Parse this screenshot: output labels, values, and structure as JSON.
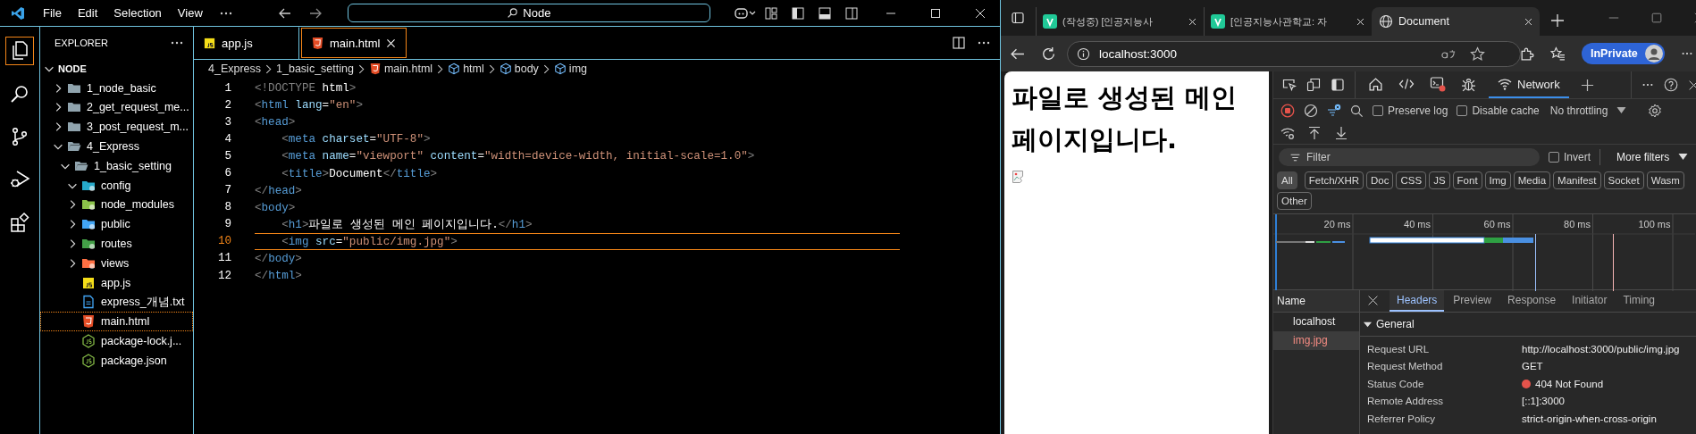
{
  "editor_app": {
    "menu": [
      {
        "label": "File"
      },
      {
        "label": "Edit"
      },
      {
        "label": "Selection"
      },
      {
        "label": "View"
      }
    ],
    "command_center": {
      "value": "Node"
    },
    "activity": [
      {
        "kind": "files",
        "selected": true
      },
      {
        "kind": "search",
        "selected": false
      },
      {
        "kind": "git",
        "selected": false
      },
      {
        "kind": "debug",
        "selected": false
      },
      {
        "kind": "extensions",
        "selected": false
      }
    ],
    "explorer": {
      "title": "EXPLORER",
      "tree": [
        {
          "label": "NODE",
          "kind": "root",
          "expanded": true,
          "selected": false,
          "children": [
            {
              "label": "1_node_basic",
              "kind": "folder",
              "expanded": false,
              "selected": false
            },
            {
              "label": "2_get_request_me...",
              "kind": "folder",
              "expanded": false,
              "selected": false
            },
            {
              "label": "3_post_request_m...",
              "kind": "folder",
              "expanded": false,
              "selected": false
            },
            {
              "label": "4_Express",
              "kind": "folder",
              "expanded": true,
              "selected": false,
              "children": [
                {
                  "label": "1_basic_setting",
                  "kind": "folder",
                  "expanded": true,
                  "selected": false,
                  "children": [
                    {
                      "label": "config",
                      "kind": "config",
                      "expanded": true,
                      "selected": false
                    },
                    {
                      "label": "node_modules",
                      "kind": "node_modules",
                      "expanded": false,
                      "selected": false
                    },
                    {
                      "label": "public",
                      "kind": "public",
                      "expanded": false,
                      "selected": false
                    },
                    {
                      "label": "routes",
                      "kind": "routes",
                      "expanded": false,
                      "selected": false
                    },
                    {
                      "label": "views",
                      "kind": "views",
                      "expanded": false,
                      "selected": false
                    },
                    {
                      "label": "app.js",
                      "kind": "js",
                      "selected": false
                    },
                    {
                      "label": "express_개념.txt",
                      "kind": "txt",
                      "selected": false
                    },
                    {
                      "label": "main.html",
                      "kind": "html",
                      "selected": true
                    },
                    {
                      "label": "package-lock.j...",
                      "kind": "json",
                      "selected": false
                    },
                    {
                      "label": "package.json",
                      "kind": "json",
                      "selected": false
                    }
                  ]
                }
              ]
            }
          ]
        }
      ]
    },
    "tabs": [
      {
        "label": "app.js",
        "kind": "js",
        "selected": false
      },
      {
        "label": "main.html",
        "kind": "html",
        "selected": true
      }
    ],
    "breadcrumbs": [
      {
        "label": "4_Express",
        "kind": "folder"
      },
      {
        "label": "1_basic_setting",
        "kind": "folder"
      },
      {
        "label": "main.html",
        "kind": "html"
      },
      {
        "label": "html",
        "kind": "element"
      },
      {
        "label": "body",
        "kind": "element"
      },
      {
        "label": "img",
        "kind": "element"
      }
    ],
    "code": [
      {
        "number": "1",
        "current": false,
        "tokens": [
          {
            "t": "<!DOCTYPE",
            "kind": "punct"
          },
          {
            "t": " html",
            "kind": "text"
          },
          {
            "t": ">",
            "kind": "punct"
          }
        ]
      },
      {
        "number": "2",
        "current": false,
        "tokens": [
          {
            "t": "<",
            "kind": "punct"
          },
          {
            "t": "html",
            "kind": "tag"
          },
          {
            "t": " lang",
            "kind": "attr"
          },
          {
            "t": "=",
            "kind": "text"
          },
          {
            "t": "\"en\"",
            "kind": "string"
          },
          {
            "t": ">",
            "kind": "punct"
          }
        ]
      },
      {
        "number": "3",
        "current": false,
        "tokens": [
          {
            "t": "<",
            "kind": "punct"
          },
          {
            "t": "head",
            "kind": "tag"
          },
          {
            "t": ">",
            "kind": "punct"
          }
        ]
      },
      {
        "number": "4",
        "current": false,
        "tokens": [
          {
            "t": "    <",
            "kind": "punct"
          },
          {
            "t": "meta",
            "kind": "tag"
          },
          {
            "t": " charset",
            "kind": "attr"
          },
          {
            "t": "=",
            "kind": "text"
          },
          {
            "t": "\"UTF-8\"",
            "kind": "string"
          },
          {
            "t": ">",
            "kind": "punct"
          }
        ]
      },
      {
        "number": "5",
        "current": false,
        "tokens": [
          {
            "t": "    <",
            "kind": "punct"
          },
          {
            "t": "meta",
            "kind": "tag"
          },
          {
            "t": " name",
            "kind": "attr"
          },
          {
            "t": "=",
            "kind": "text"
          },
          {
            "t": "\"viewport\"",
            "kind": "string"
          },
          {
            "t": " content",
            "kind": "attr"
          },
          {
            "t": "=",
            "kind": "text"
          },
          {
            "t": "\"width=device-width, initial-scale=1.0\"",
            "kind": "string"
          },
          {
            "t": ">",
            "kind": "punct"
          }
        ]
      },
      {
        "number": "6",
        "current": false,
        "tokens": [
          {
            "t": "    <",
            "kind": "punct"
          },
          {
            "t": "title",
            "kind": "tag"
          },
          {
            "t": ">",
            "kind": "punct"
          },
          {
            "t": "Document",
            "kind": "text"
          },
          {
            "t": "</",
            "kind": "punct"
          },
          {
            "t": "title",
            "kind": "tag"
          },
          {
            "t": ">",
            "kind": "punct"
          }
        ]
      },
      {
        "number": "7",
        "current": false,
        "tokens": [
          {
            "t": "</",
            "kind": "punct"
          },
          {
            "t": "head",
            "kind": "tag"
          },
          {
            "t": ">",
            "kind": "punct"
          }
        ]
      },
      {
        "number": "8",
        "current": false,
        "tokens": [
          {
            "t": "<",
            "kind": "punct"
          },
          {
            "t": "body",
            "kind": "tag"
          },
          {
            "t": ">",
            "kind": "punct"
          }
        ]
      },
      {
        "number": "9",
        "current": false,
        "tokens": [
          {
            "t": "    <",
            "kind": "punct"
          },
          {
            "t": "h1",
            "kind": "tag"
          },
          {
            "t": ">",
            "kind": "punct"
          },
          {
            "t": "파일로 생성된 메인 페이지입니다.",
            "kind": "text"
          },
          {
            "t": "</",
            "kind": "punct"
          },
          {
            "t": "h1",
            "kind": "tag"
          },
          {
            "t": ">",
            "kind": "punct"
          }
        ]
      },
      {
        "number": "10",
        "current": true,
        "tokens": [
          {
            "t": "    <",
            "kind": "punct"
          },
          {
            "t": "img",
            "kind": "tag"
          },
          {
            "t": " src",
            "kind": "attr"
          },
          {
            "t": "=",
            "kind": "text"
          },
          {
            "t": "\"public/img.jpg\"",
            "kind": "string"
          },
          {
            "t": ">",
            "kind": "punct"
          }
        ]
      },
      {
        "number": "11",
        "current": false,
        "tokens": [
          {
            "t": "</",
            "kind": "punct"
          },
          {
            "t": "body",
            "kind": "tag"
          },
          {
            "t": ">",
            "kind": "punct"
          }
        ]
      },
      {
        "number": "12",
        "current": false,
        "tokens": [
          {
            "t": "</",
            "kind": "punct"
          },
          {
            "t": "html",
            "kind": "tag"
          },
          {
            "t": ">",
            "kind": "punct"
          }
        ]
      }
    ]
  },
  "browser": {
    "tabs": [
      {
        "title": "(작성중) [인공지능사",
        "kind": "site",
        "selected": false
      },
      {
        "title": "[인공지능사관학교: 자",
        "kind": "site",
        "selected": false
      },
      {
        "title": "Document",
        "kind": "globe",
        "selected": true
      }
    ],
    "address": "localhost:3000",
    "profile": "InPrivate",
    "page": {
      "heading": "파일로 생성된 메인 페이지입니다."
    },
    "devtools": {
      "panel_tabs": [
        {
          "kind": "home",
          "selected": false
        },
        {
          "kind": "elements",
          "selected": false
        },
        {
          "kind": "console",
          "selected": false
        },
        {
          "kind": "sources",
          "selected": false
        },
        {
          "kind": "network",
          "label": "Network",
          "selected": true
        }
      ],
      "preserve_log": {
        "label": "Preserve log",
        "checked": false
      },
      "disable_cache": {
        "label": "Disable cache",
        "checked": false
      },
      "throttling": "No throttling",
      "filter": {
        "placeholder": "Filter"
      },
      "invert": {
        "label": "Invert",
        "checked": false
      },
      "more_filters": "More filters",
      "types": [
        {
          "label": "All",
          "selected": true
        },
        {
          "label": "Fetch/XHR",
          "selected": false
        },
        {
          "label": "Doc",
          "selected": false
        },
        {
          "label": "CSS",
          "selected": false
        },
        {
          "label": "JS",
          "selected": false
        },
        {
          "label": "Font",
          "selected": false
        },
        {
          "label": "Img",
          "selected": false
        },
        {
          "label": "Media",
          "selected": false
        },
        {
          "label": "Manifest",
          "selected": false
        },
        {
          "label": "Socket",
          "selected": false
        },
        {
          "label": "Wasm",
          "selected": false
        },
        {
          "label": "Other",
          "selected": false
        }
      ],
      "timeline_ticks": [
        "20 ms",
        "40 ms",
        "60 ms",
        "80 ms",
        "100 ms"
      ],
      "name_header": "Name",
      "requests": [
        {
          "name": "localhost",
          "selected": false,
          "failed": false
        },
        {
          "name": "img.jpg",
          "selected": true,
          "failed": true
        }
      ],
      "detail_tabs": [
        {
          "label": "Headers",
          "selected": true
        },
        {
          "label": "Preview",
          "selected": false
        },
        {
          "label": "Response",
          "selected": false
        },
        {
          "label": "Initiator",
          "selected": false
        },
        {
          "label": "Timing",
          "selected": false
        }
      ],
      "section": {
        "title": "General",
        "expanded": true
      },
      "headers": [
        {
          "label": "Request URL",
          "value": "http://localhost:3000/public/img.jpg",
          "kind": "text"
        },
        {
          "label": "Request Method",
          "value": "GET",
          "kind": "text"
        },
        {
          "label": "Status Code",
          "value": "404 Not Found",
          "kind": "status"
        },
        {
          "label": "Remote Address",
          "value": "[::1]:3000",
          "kind": "text"
        },
        {
          "label": "Referrer Policy",
          "value": "strict-origin-when-cross-origin",
          "kind": "text"
        }
      ]
    }
  }
}
